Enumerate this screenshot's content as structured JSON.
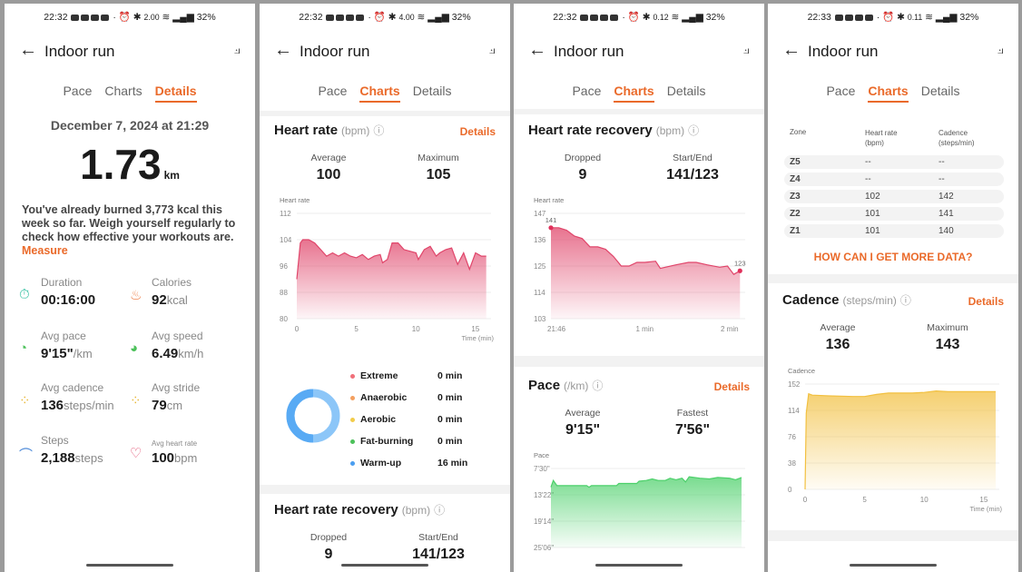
{
  "panels": [
    {
      "status": {
        "time": "22:32",
        "net": "2.00",
        "battery": "32%"
      }
    },
    {
      "status": {
        "time": "22:32",
        "net": "4.00",
        "battery": "32%"
      }
    },
    {
      "status": {
        "time": "22:32",
        "net": "0.12",
        "battery": "32%"
      }
    },
    {
      "status": {
        "time": "22:33",
        "net": "0.11",
        "battery": "32%"
      }
    }
  ],
  "header": {
    "title": "Indoor run",
    "tabs": [
      "Pace",
      "Charts",
      "Details"
    ]
  },
  "details": {
    "date": "December 7, 2024 at 21:29",
    "distance": "1.73",
    "distance_unit": "km",
    "message": "You've already burned 3,773 kcal this week so far. Weigh yourself regularly to check how effective your workouts are.",
    "measure": "Measure",
    "stats": [
      {
        "label": "Duration",
        "value": "00:16:00",
        "unit": "",
        "icon": "stopwatch-icon",
        "color": "#2fbfa0"
      },
      {
        "label": "Calories",
        "value": "92",
        "unit": "kcal",
        "icon": "flame-icon",
        "color": "#ef7d45"
      },
      {
        "label": "Avg pace",
        "value": "9'15\"",
        "unit": "/km",
        "icon": "speedometer-icon",
        "color": "#4cc15a"
      },
      {
        "label": "Avg speed",
        "value": "6.49",
        "unit": "km/h",
        "icon": "gauge-icon",
        "color": "#4cc15a"
      },
      {
        "label": "Avg cadence",
        "value": "136",
        "unit": "steps/min",
        "icon": "footprints-icon",
        "color": "#e8b93a"
      },
      {
        "label": "Avg stride",
        "value": "79",
        "unit": "cm",
        "icon": "footprints-icon",
        "color": "#e8b93a"
      },
      {
        "label": "Steps",
        "value": "2,188",
        "unit": "steps",
        "icon": "shoe-icon",
        "color": "#4a88d8"
      },
      {
        "label": "Avg heart rate",
        "value": "100",
        "unit": "bpm",
        "icon": "heart-icon",
        "color": "#e0456a"
      }
    ]
  },
  "heart_rate": {
    "title": "Heart rate",
    "unit": "(bpm)",
    "details": "Details",
    "avg_label": "Average",
    "avg": "100",
    "max_label": "Maximum",
    "max": "105",
    "zones": [
      {
        "name": "Extreme",
        "value": "0 min",
        "color": "#f0707a"
      },
      {
        "name": "Anaerobic",
        "value": "0 min",
        "color": "#f4a060"
      },
      {
        "name": "Aerobic",
        "value": "0 min",
        "color": "#f2cc4a"
      },
      {
        "name": "Fat-burning",
        "value": "0 min",
        "color": "#4cc15a"
      },
      {
        "name": "Warm-up",
        "value": "16 min",
        "color": "#4a9ef0"
      }
    ]
  },
  "hr_recovery": {
    "title": "Heart rate recovery",
    "unit": "(bpm)",
    "dropped_label": "Dropped",
    "dropped": "9",
    "startend_label": "Start/End",
    "startend": "141/123"
  },
  "pace": {
    "title": "Pace",
    "unit": "(/km)",
    "details": "Details",
    "avg_label": "Average",
    "avg": "9'15\"",
    "fast_label": "Fastest",
    "fast": "7'56\""
  },
  "zone_table": {
    "headers": [
      "Zone",
      "Heart rate\n(bpm)",
      "Cadence\n(steps/min)"
    ],
    "rows": [
      [
        "Z5",
        "--",
        "--"
      ],
      [
        "Z4",
        "--",
        "--"
      ],
      [
        "Z3",
        "102",
        "142"
      ],
      [
        "Z2",
        "101",
        "141"
      ],
      [
        "Z1",
        "101",
        "140"
      ]
    ],
    "link": "HOW CAN I GET MORE DATA?"
  },
  "cadence": {
    "title": "Cadence",
    "unit": "(steps/min)",
    "details": "Details",
    "avg_label": "Average",
    "avg": "136",
    "max_label": "Maximum",
    "max": "143"
  },
  "chart_data": [
    {
      "type": "area",
      "ylabel": "Heart rate",
      "xlabel": "Time (min)",
      "ylim": [
        80,
        112
      ],
      "yticks": [
        "112",
        "104",
        "96",
        "88",
        "80"
      ],
      "xlim": [
        0,
        16
      ],
      "xticks": [
        [
          0,
          "0"
        ],
        [
          5,
          "5"
        ],
        [
          10,
          "10"
        ],
        [
          15,
          "15"
        ]
      ],
      "color": "#e0456a",
      "points": [
        [
          0,
          92
        ],
        [
          0.3,
          103
        ],
        [
          0.5,
          104
        ],
        [
          1,
          104
        ],
        [
          1.5,
          103
        ],
        [
          2,
          101
        ],
        [
          2.5,
          99
        ],
        [
          3,
          100
        ],
        [
          3.5,
          99
        ],
        [
          4,
          100
        ],
        [
          4.5,
          99
        ],
        [
          5,
          98.5
        ],
        [
          5.5,
          99.5
        ],
        [
          6,
          98
        ],
        [
          6.5,
          99
        ],
        [
          7,
          99.5
        ],
        [
          7.2,
          97
        ],
        [
          7.6,
          98
        ],
        [
          8,
          103
        ],
        [
          8.5,
          103
        ],
        [
          9,
          101
        ],
        [
          9.5,
          100.5
        ],
        [
          10,
          100
        ],
        [
          10.2,
          98
        ],
        [
          10.7,
          101
        ],
        [
          11.2,
          102
        ],
        [
          11.7,
          99
        ],
        [
          12,
          100
        ],
        [
          12.5,
          101
        ],
        [
          13,
          101.5
        ],
        [
          13.5,
          96.5
        ],
        [
          14,
          100
        ],
        [
          14.5,
          95
        ],
        [
          15,
          100
        ],
        [
          15.5,
          99
        ],
        [
          15.9,
          99
        ]
      ]
    },
    {
      "type": "area",
      "ylabel": "Heart rate",
      "xlabel": "",
      "ylim": [
        103,
        147
      ],
      "yticks": [
        "147",
        "136",
        "125",
        "114",
        "103"
      ],
      "xlim": [
        0,
        122
      ],
      "xticks": [
        [
          0,
          "21:46"
        ],
        [
          60,
          "1 min"
        ],
        [
          120,
          "2 min"
        ]
      ],
      "color": "#e0456a",
      "annotations": [
        {
          "x": 0,
          "y": 141,
          "label": "141"
        },
        {
          "x": 121,
          "y": 123,
          "label": "123"
        }
      ],
      "points": [
        [
          0,
          141
        ],
        [
          5,
          141
        ],
        [
          10,
          140
        ],
        [
          15,
          137.5
        ],
        [
          20,
          136.5
        ],
        [
          25,
          133
        ],
        [
          30,
          133
        ],
        [
          35,
          132
        ],
        [
          40,
          129
        ],
        [
          45,
          125
        ],
        [
          50,
          125
        ],
        [
          55,
          126.5
        ],
        [
          60,
          126.5
        ],
        [
          67,
          127
        ],
        [
          70,
          124
        ],
        [
          80,
          125.5
        ],
        [
          88,
          126.5
        ],
        [
          93,
          126.5
        ],
        [
          100,
          125.5
        ],
        [
          108,
          124.5
        ],
        [
          113,
          125
        ],
        [
          117,
          121.5
        ],
        [
          121,
          123
        ]
      ]
    },
    {
      "type": "area",
      "ylabel": "Pace",
      "inverted": true,
      "ylim": [
        "7'30\"",
        "25'06\""
      ],
      "yticks": [
        "7'30\"",
        "13'22\"",
        "19'14\"",
        "25'06\""
      ],
      "xlim": [
        0,
        16
      ],
      "xticks": [],
      "color": "#4cd06a",
      "points": [
        [
          0,
          "11'40\""
        ],
        [
          0.2,
          "10'10\""
        ],
        [
          0.5,
          "11'20\""
        ],
        [
          3,
          "11'20\""
        ],
        [
          3.2,
          "11'40\""
        ],
        [
          3.4,
          "11'20\""
        ],
        [
          5.5,
          "11'20\""
        ],
        [
          5.7,
          "10'50\""
        ],
        [
          7.2,
          "10'50\""
        ],
        [
          7.4,
          "10'20\""
        ],
        [
          8,
          "10'10\""
        ],
        [
          8.5,
          "9'50\""
        ],
        [
          9,
          "10'10\""
        ],
        [
          9.6,
          "10'10\""
        ],
        [
          10,
          "9'40\""
        ],
        [
          10.5,
          "10'00\""
        ],
        [
          11,
          "9'40\""
        ],
        [
          11.3,
          "10'30\""
        ],
        [
          11.6,
          "9'20\""
        ],
        [
          12.5,
          "9'40\""
        ],
        [
          13.3,
          "9'50\""
        ],
        [
          14,
          "9'30\""
        ],
        [
          15,
          "9'40\""
        ],
        [
          15.5,
          "10'00\""
        ],
        [
          16,
          "9'30\""
        ]
      ]
    },
    {
      "type": "area",
      "ylabel": "Cadence",
      "xlabel": "Time (min)",
      "ylim": [
        0,
        152
      ],
      "yticks": [
        "152",
        "114",
        "76",
        "38",
        "0"
      ],
      "xlim": [
        0,
        16
      ],
      "xticks": [
        [
          0,
          "0"
        ],
        [
          5,
          "5"
        ],
        [
          10,
          "10"
        ],
        [
          15,
          "15"
        ]
      ],
      "color": "#f2c040",
      "points": [
        [
          0,
          0
        ],
        [
          0.1,
          110
        ],
        [
          0.3,
          138
        ],
        [
          0.6,
          136
        ],
        [
          2,
          135
        ],
        [
          4,
          134
        ],
        [
          5,
          134
        ],
        [
          6,
          137
        ],
        [
          7,
          139
        ],
        [
          8,
          139
        ],
        [
          9,
          139
        ],
        [
          10,
          140
        ],
        [
          11,
          142
        ],
        [
          12,
          141
        ],
        [
          14,
          141
        ],
        [
          16,
          141
        ]
      ]
    }
  ]
}
